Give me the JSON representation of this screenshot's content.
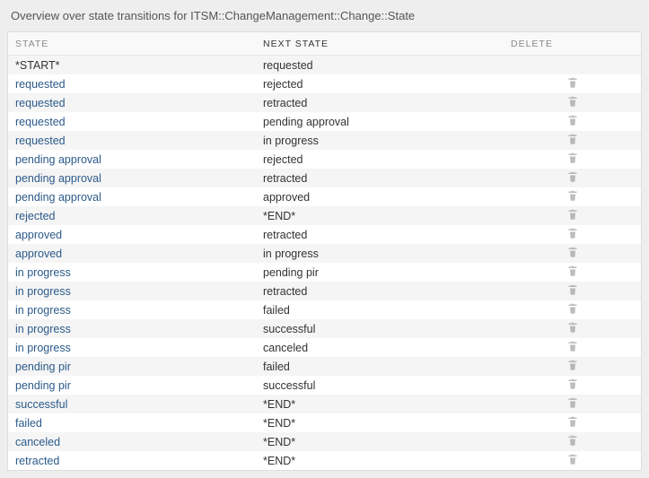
{
  "title": "Overview over state transitions for ITSM::ChangeManagement::Change::State",
  "columns": {
    "state": "State",
    "next": "Next State",
    "delete": "Delete"
  },
  "terminals": {
    "start": "*START*",
    "end": "*END*"
  },
  "rows": [
    {
      "state": "*START*",
      "stateLink": false,
      "next": "requested",
      "deletable": false
    },
    {
      "state": "requested",
      "stateLink": true,
      "next": "rejected",
      "deletable": true
    },
    {
      "state": "requested",
      "stateLink": true,
      "next": "retracted",
      "deletable": true
    },
    {
      "state": "requested",
      "stateLink": true,
      "next": "pending approval",
      "deletable": true
    },
    {
      "state": "requested",
      "stateLink": true,
      "next": "in progress",
      "deletable": true
    },
    {
      "state": "pending approval",
      "stateLink": true,
      "next": "rejected",
      "deletable": true
    },
    {
      "state": "pending approval",
      "stateLink": true,
      "next": "retracted",
      "deletable": true
    },
    {
      "state": "pending approval",
      "stateLink": true,
      "next": "approved",
      "deletable": true
    },
    {
      "state": "rejected",
      "stateLink": true,
      "next": "*END*",
      "deletable": true
    },
    {
      "state": "approved",
      "stateLink": true,
      "next": "retracted",
      "deletable": true
    },
    {
      "state": "approved",
      "stateLink": true,
      "next": "in progress",
      "deletable": true
    },
    {
      "state": "in progress",
      "stateLink": true,
      "next": "pending pir",
      "deletable": true
    },
    {
      "state": "in progress",
      "stateLink": true,
      "next": "retracted",
      "deletable": true
    },
    {
      "state": "in progress",
      "stateLink": true,
      "next": "failed",
      "deletable": true
    },
    {
      "state": "in progress",
      "stateLink": true,
      "next": "successful",
      "deletable": true
    },
    {
      "state": "in progress",
      "stateLink": true,
      "next": "canceled",
      "deletable": true
    },
    {
      "state": "pending pir",
      "stateLink": true,
      "next": "failed",
      "deletable": true
    },
    {
      "state": "pending pir",
      "stateLink": true,
      "next": "successful",
      "deletable": true
    },
    {
      "state": "successful",
      "stateLink": true,
      "next": "*END*",
      "deletable": true
    },
    {
      "state": "failed",
      "stateLink": true,
      "next": "*END*",
      "deletable": true
    },
    {
      "state": "canceled",
      "stateLink": true,
      "next": "*END*",
      "deletable": true
    },
    {
      "state": "retracted",
      "stateLink": true,
      "next": "*END*",
      "deletable": true
    }
  ]
}
